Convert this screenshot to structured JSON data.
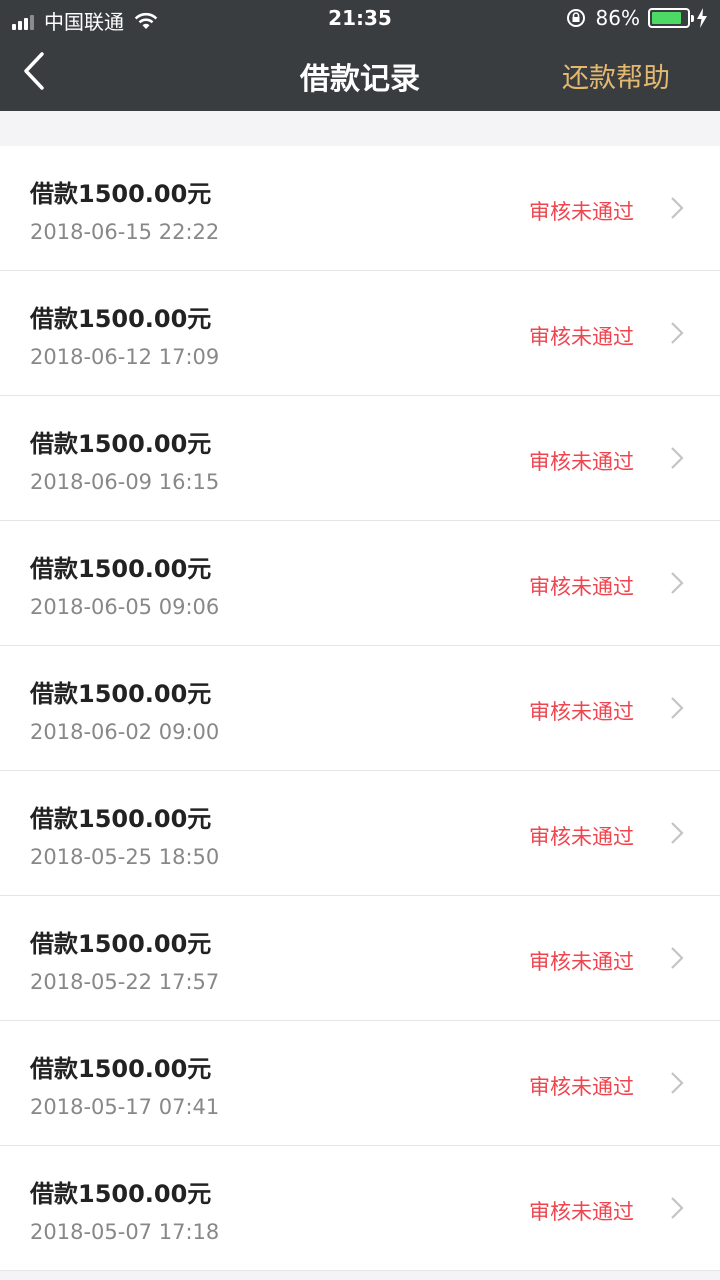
{
  "status_bar": {
    "carrier": "中国联通",
    "time": "21:35",
    "battery": "86%",
    "battery_level": 0.86
  },
  "nav": {
    "title": "借款记录",
    "help": "还款帮助"
  },
  "colors": {
    "header_bg": "#3a3d40",
    "help_text": "#e3b96f",
    "status_rejected": "#f0454f",
    "battery_fill": "#4cd964"
  },
  "records": [
    {
      "amount": "借款1500.00元",
      "time": "2018-06-15 22:22",
      "status": "审核未通过"
    },
    {
      "amount": "借款1500.00元",
      "time": "2018-06-12 17:09",
      "status": "审核未通过"
    },
    {
      "amount": "借款1500.00元",
      "time": "2018-06-09 16:15",
      "status": "审核未通过"
    },
    {
      "amount": "借款1500.00元",
      "time": "2018-06-05 09:06",
      "status": "审核未通过"
    },
    {
      "amount": "借款1500.00元",
      "time": "2018-06-02 09:00",
      "status": "审核未通过"
    },
    {
      "amount": "借款1500.00元",
      "time": "2018-05-25 18:50",
      "status": "审核未通过"
    },
    {
      "amount": "借款1500.00元",
      "time": "2018-05-22 17:57",
      "status": "审核未通过"
    },
    {
      "amount": "借款1500.00元",
      "time": "2018-05-17 07:41",
      "status": "审核未通过"
    },
    {
      "amount": "借款1500.00元",
      "time": "2018-05-07 17:18",
      "status": "审核未通过"
    }
  ]
}
